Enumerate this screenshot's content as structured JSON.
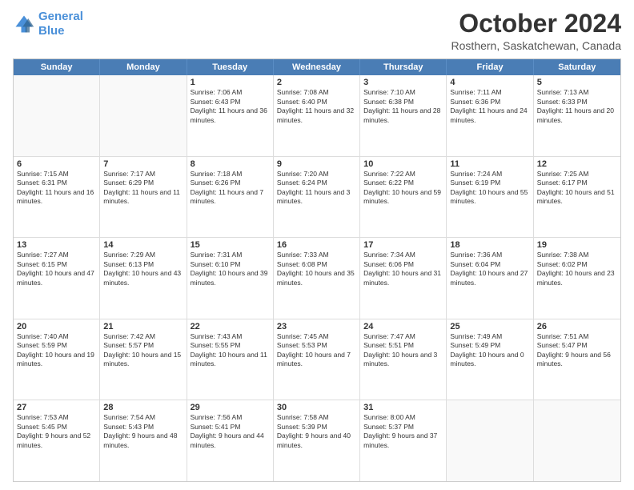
{
  "logo": {
    "line1": "General",
    "line2": "Blue"
  },
  "title": "October 2024",
  "subtitle": "Rosthern, Saskatchewan, Canada",
  "header_days": [
    "Sunday",
    "Monday",
    "Tuesday",
    "Wednesday",
    "Thursday",
    "Friday",
    "Saturday"
  ],
  "weeks": [
    [
      {
        "day": "",
        "sunrise": "",
        "sunset": "",
        "daylight": ""
      },
      {
        "day": "",
        "sunrise": "",
        "sunset": "",
        "daylight": ""
      },
      {
        "day": "1",
        "sunrise": "Sunrise: 7:06 AM",
        "sunset": "Sunset: 6:43 PM",
        "daylight": "Daylight: 11 hours and 36 minutes."
      },
      {
        "day": "2",
        "sunrise": "Sunrise: 7:08 AM",
        "sunset": "Sunset: 6:40 PM",
        "daylight": "Daylight: 11 hours and 32 minutes."
      },
      {
        "day": "3",
        "sunrise": "Sunrise: 7:10 AM",
        "sunset": "Sunset: 6:38 PM",
        "daylight": "Daylight: 11 hours and 28 minutes."
      },
      {
        "day": "4",
        "sunrise": "Sunrise: 7:11 AM",
        "sunset": "Sunset: 6:36 PM",
        "daylight": "Daylight: 11 hours and 24 minutes."
      },
      {
        "day": "5",
        "sunrise": "Sunrise: 7:13 AM",
        "sunset": "Sunset: 6:33 PM",
        "daylight": "Daylight: 11 hours and 20 minutes."
      }
    ],
    [
      {
        "day": "6",
        "sunrise": "Sunrise: 7:15 AM",
        "sunset": "Sunset: 6:31 PM",
        "daylight": "Daylight: 11 hours and 16 minutes."
      },
      {
        "day": "7",
        "sunrise": "Sunrise: 7:17 AM",
        "sunset": "Sunset: 6:29 PM",
        "daylight": "Daylight: 11 hours and 11 minutes."
      },
      {
        "day": "8",
        "sunrise": "Sunrise: 7:18 AM",
        "sunset": "Sunset: 6:26 PM",
        "daylight": "Daylight: 11 hours and 7 minutes."
      },
      {
        "day": "9",
        "sunrise": "Sunrise: 7:20 AM",
        "sunset": "Sunset: 6:24 PM",
        "daylight": "Daylight: 11 hours and 3 minutes."
      },
      {
        "day": "10",
        "sunrise": "Sunrise: 7:22 AM",
        "sunset": "Sunset: 6:22 PM",
        "daylight": "Daylight: 10 hours and 59 minutes."
      },
      {
        "day": "11",
        "sunrise": "Sunrise: 7:24 AM",
        "sunset": "Sunset: 6:19 PM",
        "daylight": "Daylight: 10 hours and 55 minutes."
      },
      {
        "day": "12",
        "sunrise": "Sunrise: 7:25 AM",
        "sunset": "Sunset: 6:17 PM",
        "daylight": "Daylight: 10 hours and 51 minutes."
      }
    ],
    [
      {
        "day": "13",
        "sunrise": "Sunrise: 7:27 AM",
        "sunset": "Sunset: 6:15 PM",
        "daylight": "Daylight: 10 hours and 47 minutes."
      },
      {
        "day": "14",
        "sunrise": "Sunrise: 7:29 AM",
        "sunset": "Sunset: 6:13 PM",
        "daylight": "Daylight: 10 hours and 43 minutes."
      },
      {
        "day": "15",
        "sunrise": "Sunrise: 7:31 AM",
        "sunset": "Sunset: 6:10 PM",
        "daylight": "Daylight: 10 hours and 39 minutes."
      },
      {
        "day": "16",
        "sunrise": "Sunrise: 7:33 AM",
        "sunset": "Sunset: 6:08 PM",
        "daylight": "Daylight: 10 hours and 35 minutes."
      },
      {
        "day": "17",
        "sunrise": "Sunrise: 7:34 AM",
        "sunset": "Sunset: 6:06 PM",
        "daylight": "Daylight: 10 hours and 31 minutes."
      },
      {
        "day": "18",
        "sunrise": "Sunrise: 7:36 AM",
        "sunset": "Sunset: 6:04 PM",
        "daylight": "Daylight: 10 hours and 27 minutes."
      },
      {
        "day": "19",
        "sunrise": "Sunrise: 7:38 AM",
        "sunset": "Sunset: 6:02 PM",
        "daylight": "Daylight: 10 hours and 23 minutes."
      }
    ],
    [
      {
        "day": "20",
        "sunrise": "Sunrise: 7:40 AM",
        "sunset": "Sunset: 5:59 PM",
        "daylight": "Daylight: 10 hours and 19 minutes."
      },
      {
        "day": "21",
        "sunrise": "Sunrise: 7:42 AM",
        "sunset": "Sunset: 5:57 PM",
        "daylight": "Daylight: 10 hours and 15 minutes."
      },
      {
        "day": "22",
        "sunrise": "Sunrise: 7:43 AM",
        "sunset": "Sunset: 5:55 PM",
        "daylight": "Daylight: 10 hours and 11 minutes."
      },
      {
        "day": "23",
        "sunrise": "Sunrise: 7:45 AM",
        "sunset": "Sunset: 5:53 PM",
        "daylight": "Daylight: 10 hours and 7 minutes."
      },
      {
        "day": "24",
        "sunrise": "Sunrise: 7:47 AM",
        "sunset": "Sunset: 5:51 PM",
        "daylight": "Daylight: 10 hours and 3 minutes."
      },
      {
        "day": "25",
        "sunrise": "Sunrise: 7:49 AM",
        "sunset": "Sunset: 5:49 PM",
        "daylight": "Daylight: 10 hours and 0 minutes."
      },
      {
        "day": "26",
        "sunrise": "Sunrise: 7:51 AM",
        "sunset": "Sunset: 5:47 PM",
        "daylight": "Daylight: 9 hours and 56 minutes."
      }
    ],
    [
      {
        "day": "27",
        "sunrise": "Sunrise: 7:53 AM",
        "sunset": "Sunset: 5:45 PM",
        "daylight": "Daylight: 9 hours and 52 minutes."
      },
      {
        "day": "28",
        "sunrise": "Sunrise: 7:54 AM",
        "sunset": "Sunset: 5:43 PM",
        "daylight": "Daylight: 9 hours and 48 minutes."
      },
      {
        "day": "29",
        "sunrise": "Sunrise: 7:56 AM",
        "sunset": "Sunset: 5:41 PM",
        "daylight": "Daylight: 9 hours and 44 minutes."
      },
      {
        "day": "30",
        "sunrise": "Sunrise: 7:58 AM",
        "sunset": "Sunset: 5:39 PM",
        "daylight": "Daylight: 9 hours and 40 minutes."
      },
      {
        "day": "31",
        "sunrise": "Sunrise: 8:00 AM",
        "sunset": "Sunset: 5:37 PM",
        "daylight": "Daylight: 9 hours and 37 minutes."
      },
      {
        "day": "",
        "sunrise": "",
        "sunset": "",
        "daylight": ""
      },
      {
        "day": "",
        "sunrise": "",
        "sunset": "",
        "daylight": ""
      }
    ]
  ]
}
